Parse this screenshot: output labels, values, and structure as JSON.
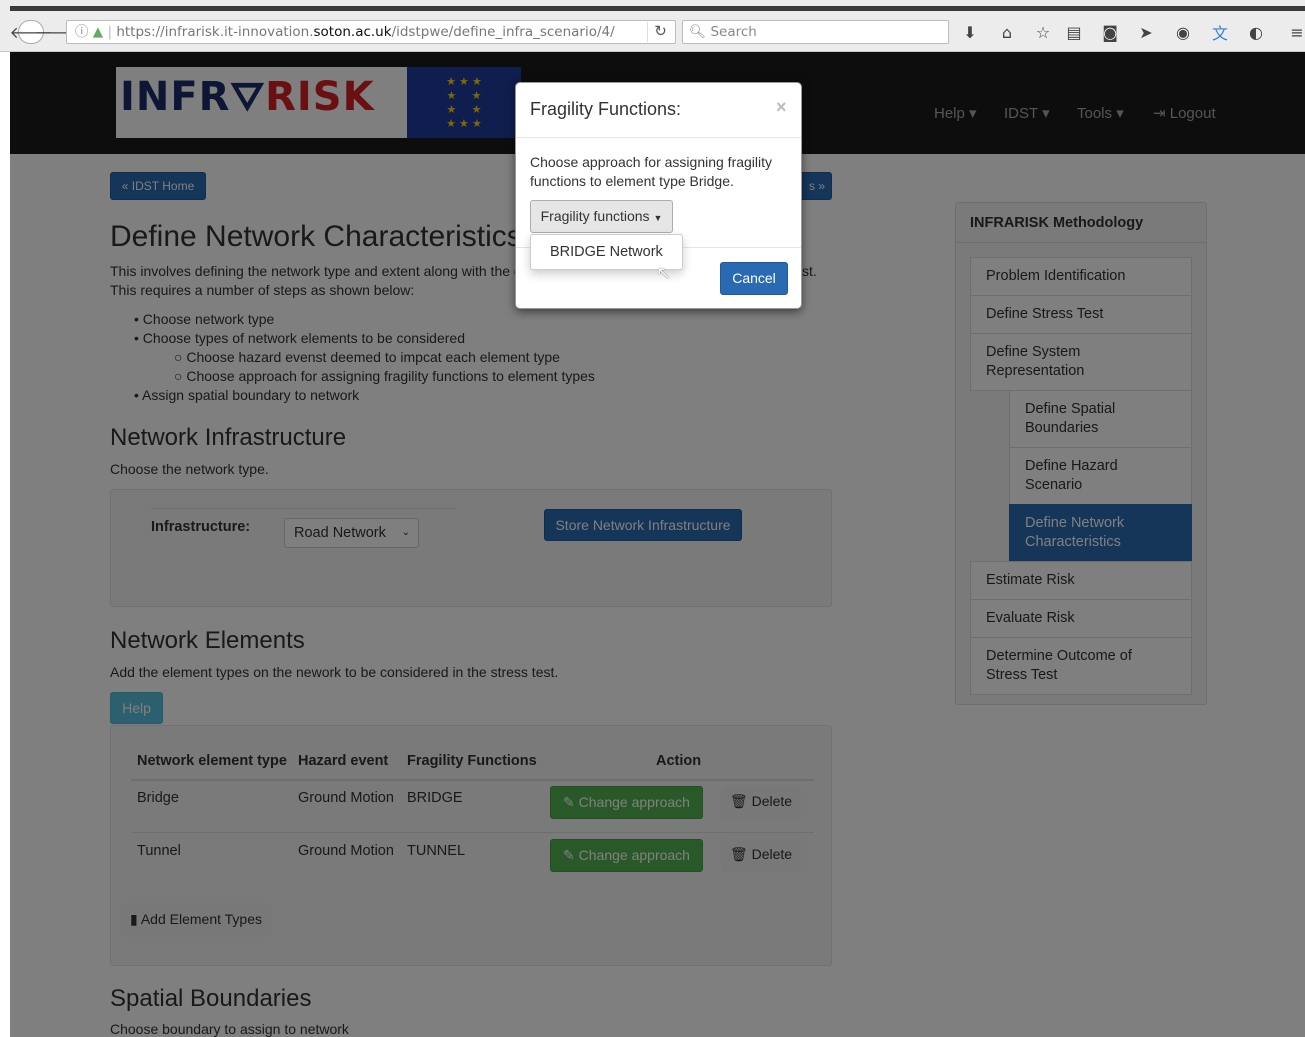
{
  "browser": {
    "url_prefix": "https://infrarisk.it-innovation.",
    "url_domain": "soton.ac.uk",
    "url_path": "/idstpwe/define_infra_scenario/4/",
    "search_placeholder": "Search"
  },
  "navbar": {
    "logo_text_1": "INFR",
    "logo_text_2": "RISK",
    "menu": [
      {
        "label": "Help"
      },
      {
        "label": "IDST"
      },
      {
        "label": "Tools"
      },
      {
        "label": "Logout"
      }
    ]
  },
  "main": {
    "home_button": "IDST Home",
    "next_button_partial": "s",
    "title": "Define Network Characteristics",
    "intro_line1": "This involves defining the network type and extent along with the e",
    "intro_line1_end": "st.",
    "intro_line2": "This requires a number of steps as shown below:",
    "steps": [
      "Choose network type",
      "Choose types of network elements to be considered",
      "Choose hazard evenst deemed to impcat each element type",
      "Choose approach for assigning fragility functions to element types",
      "Assign spatial boundary to network"
    ],
    "infra_title": "Network Infrastructure",
    "infra_desc": "Choose the network type.",
    "infra_label": "Infrastructure:",
    "infra_selected": "Road Network",
    "store_button": "Store Network Infrastructure",
    "elements_title": "Network Elements",
    "elements_desc": "Add the element types on the nework to be considered in the stress test.",
    "help_button": "Help",
    "table": {
      "headers": [
        "Network element type",
        "Hazard event",
        "Fragility Functions",
        "Action"
      ],
      "rows": [
        {
          "type": "Bridge",
          "hazard": "Ground Motion",
          "fragility": "BRIDGE",
          "change": "Change approach",
          "delete": "Delete"
        },
        {
          "type": "Tunnel",
          "hazard": "Ground Motion",
          "fragility": "TUNNEL",
          "change": "Change approach",
          "delete": "Delete"
        }
      ]
    },
    "add_button": "Add Element Types",
    "spatial_title": "Spatial Boundaries",
    "spatial_desc": "Choose boundary to assign to network"
  },
  "sidebar": {
    "heading": "INFRARISK Methodology",
    "items": [
      "Problem Identification",
      "Define Stress Test",
      "Define System Representation",
      "Define Spatial Boundaries",
      "Define Hazard Scenario",
      "Define Network Characteristics",
      "Estimate Risk",
      "Evaluate Risk",
      "Determine Outcome of Stress Test"
    ]
  },
  "modal": {
    "title": "Fragility Functions:",
    "close": "×",
    "body": "Choose approach for assigning fragility functions to element type Bridge.",
    "dropdown_label": "Fragility functions",
    "dropdown_option": "BRIDGE Network",
    "cancel": "Cancel"
  },
  "colors": {
    "primary": "#2a6ab3",
    "success": "#52b352",
    "navbar": "#1b1b1b"
  }
}
